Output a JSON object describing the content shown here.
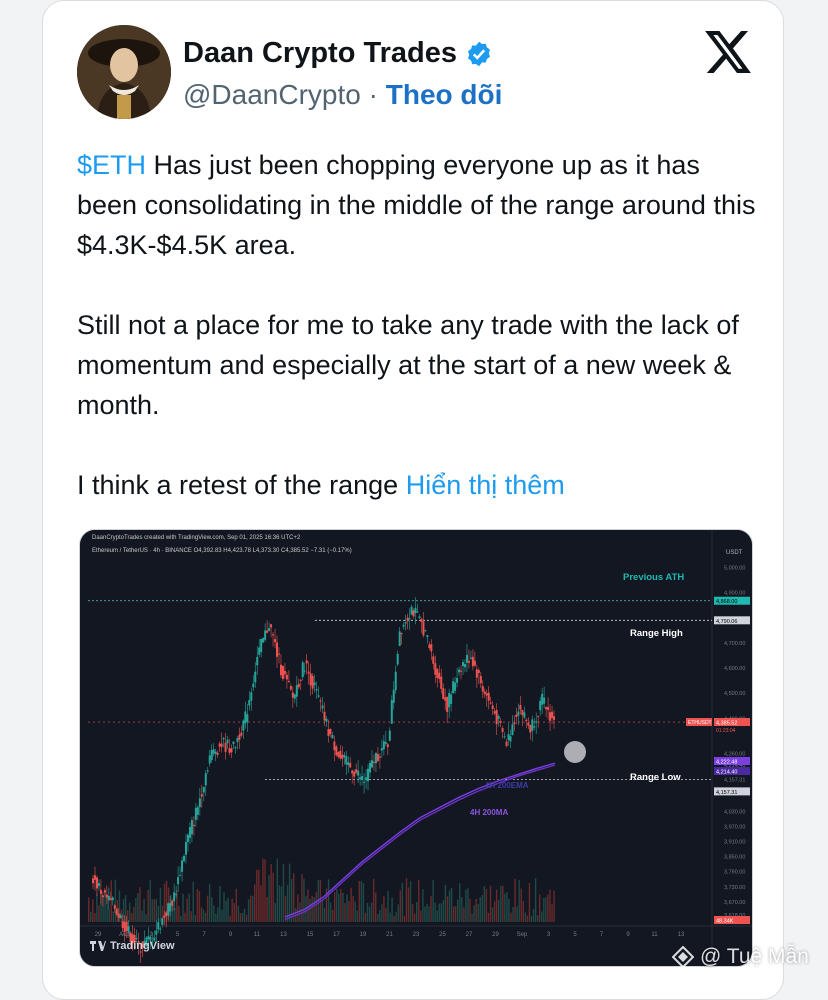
{
  "post": {
    "display_name": "Daan Crypto Trades",
    "handle": "@DaanCrypto",
    "separator": "·",
    "follow_label": "Theo dõi",
    "paragraphs": {
      "p1_cashtag": "$ETH",
      "p1_rest": " Has just been chopping everyone up as it has been consolidating in the middle of the range around this $4.3K-$4.5K area.",
      "p2": "Still not a place for me to take any trade with the lack of momentum and especially at the start of a new week & month.",
      "p3_text": "I think a retest of the range ",
      "show_more": "Hiển thị thêm"
    }
  },
  "chart_header": {
    "created_line": "DaanCryptoTrades created with TradingView.com, Sep 01, 2025 16:36 UTC+2",
    "symbol_line": "Ethereum / TetherUS · 4h · BINANCE  O4,392.83 H4,423.78 L4,373.30 C4,385.52 −7.31 (−0.17%)",
    "currency": "USDT",
    "brand": "TradingView"
  },
  "chart_data": {
    "type": "line",
    "title": "",
    "y_ticks": [
      5000,
      4900,
      4790.06,
      4700,
      4600,
      4500,
      4400,
      4260,
      4214.4,
      4157.31,
      4105,
      4030,
      3970,
      3910,
      3850,
      3790,
      3730,
      3670,
      3618
    ],
    "x_ticks": [
      "29",
      "Aug",
      "3",
      "5",
      "7",
      "9",
      "11",
      "13",
      "15",
      "17",
      "19",
      "21",
      "23",
      "25",
      "27",
      "29",
      "Sep",
      "3",
      "5",
      "7",
      "9",
      "11",
      "13"
    ],
    "annotations": [
      "Previous ATH",
      "Range High",
      "Range Low",
      "4H 200EMA",
      "4H 200MA"
    ],
    "levels": {
      "previous_ath": 4868,
      "range_high": 4790.06,
      "range_low": 4157.31,
      "price": 4385.52,
      "ema200": 4222.48,
      "ma200": 4214.4
    },
    "series": [
      {
        "name": "ETH/USDT",
        "values": [
          3780,
          3700,
          3650,
          3560,
          3490,
          3520,
          3600,
          3690,
          3900,
          4050,
          4250,
          4300,
          4280,
          4400,
          4640,
          4780,
          4600,
          4480,
          4620,
          4500,
          4350,
          4240,
          4200,
          4150,
          4250,
          4300,
          4750,
          4840,
          4760,
          4600,
          4450,
          4600,
          4650,
          4520,
          4420,
          4300,
          4450,
          4360,
          4470,
          4385
        ]
      },
      {
        "name": "4H 200EMA",
        "values": [
          3610,
          3640,
          3690,
          3760,
          3830,
          3890,
          3950,
          4005,
          4045,
          4085,
          4120,
          4150,
          4175,
          4200,
          4222
        ]
      },
      {
        "name": "4H 200MA",
        "values": [
          3600,
          3630,
          3680,
          3750,
          3820,
          3880,
          3940,
          3995,
          4035,
          4075,
          4110,
          4140,
          4168,
          4192,
          4214
        ]
      }
    ],
    "price_labels": {
      "ath_badge": "4,868.00",
      "range_high_badge": "4,790.06",
      "price_badge": "4,385.52",
      "price_sub": "01:23:04",
      "symbol_badge": "ETHUSDT",
      "ema_badge": "4,222.48",
      "ma_badge": "4,214.40",
      "range_low_badge": "4,157.31",
      "vol_badge": "48.34K"
    },
    "colors": {
      "bg": "#131722",
      "up": "#26a69a",
      "down": "#ef5350",
      "ema": "#7b3fe4",
      "ath_label": "#1fb9b0"
    }
  },
  "watermark": "@ Tuệ Mẫn"
}
